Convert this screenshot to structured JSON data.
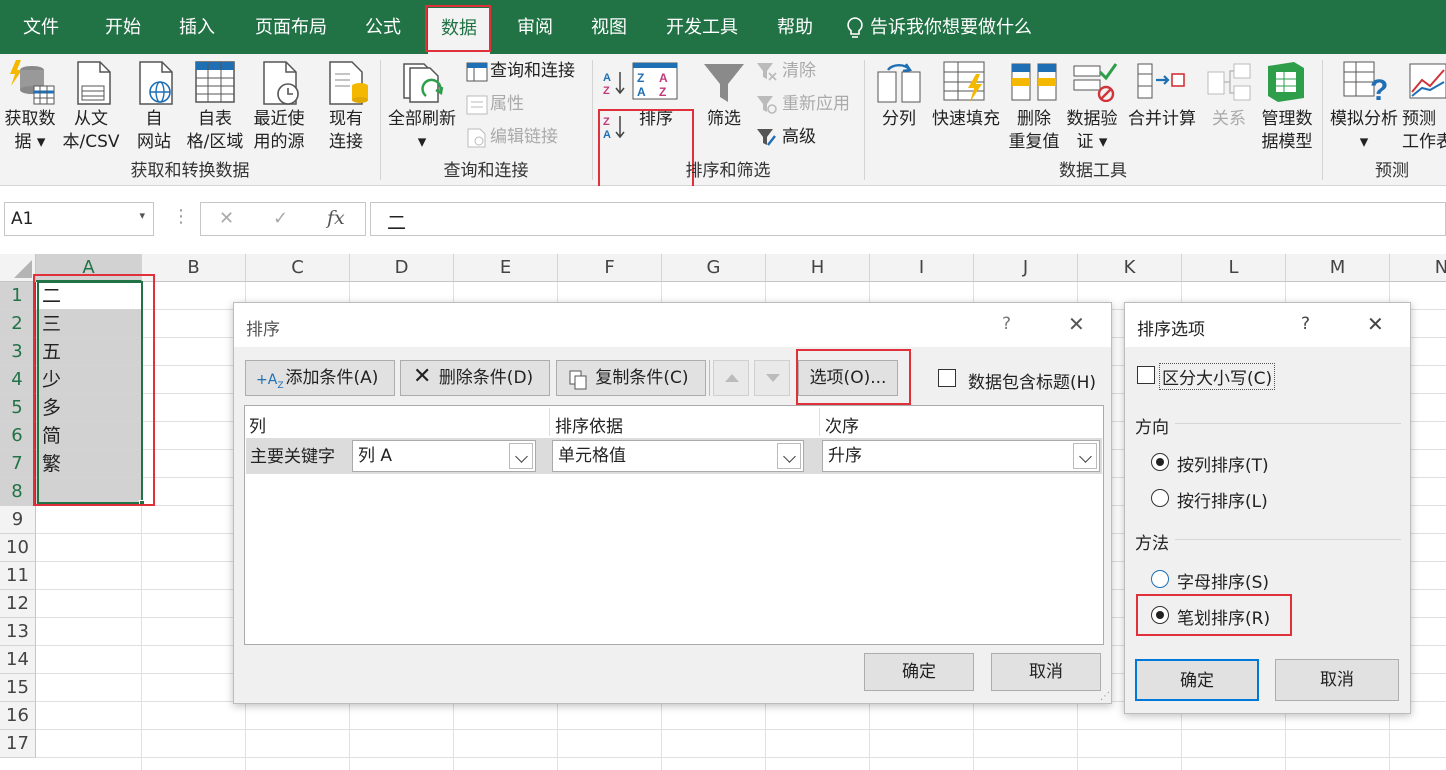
{
  "menu": {
    "tabs": [
      "文件",
      "开始",
      "插入",
      "页面布局",
      "公式",
      "数据",
      "审阅",
      "视图",
      "开发工具",
      "帮助"
    ],
    "tell_me": "告诉我你想要做什么"
  },
  "ribbon": {
    "get_data": {
      "l1": "获取数",
      "l2": "据"
    },
    "from_csv": {
      "l1": "从文",
      "l2": "本/CSV"
    },
    "from_web": {
      "l1": "自",
      "l2": "网站"
    },
    "from_table": {
      "l1": "自表",
      "l2": "格/区域"
    },
    "recent_sources": {
      "l1": "最近使",
      "l2": "用的源"
    },
    "existing_conn": {
      "l1": "现有",
      "l2": "连接"
    },
    "group_get": "获取和转换数据",
    "refresh_all": "全部刷新",
    "queries_conn": "查询和连接",
    "properties": "属性",
    "edit_links": "编辑链接",
    "group_query": "查询和连接",
    "sort": "排序",
    "filter": "筛选",
    "clear": "清除",
    "reapply": "重新应用",
    "advanced": "高级",
    "group_sort": "排序和筛选",
    "text_to_col": "分列",
    "flash_fill": "快速填充",
    "remove_dup": {
      "l1": "删除",
      "l2": "重复值"
    },
    "data_valid": {
      "l1": "数据验",
      "l2": "证"
    },
    "consolidate": "合并计算",
    "relations": "关系",
    "data_model": {
      "l1": "管理数",
      "l2": "据模型"
    },
    "group_tools": "数据工具",
    "what_if": "模拟分析",
    "forecast_sheet": {
      "l1": "预测",
      "l2": "工作表"
    },
    "group_forecast": "预测"
  },
  "formula_bar": {
    "name_box": "A1",
    "cancel": "✕",
    "enter": "✓",
    "fx": "fx",
    "value": "二"
  },
  "columns": [
    "A",
    "B",
    "C",
    "D",
    "E",
    "F",
    "G",
    "H",
    "I",
    "J",
    "K",
    "L",
    "M",
    "N"
  ],
  "rows": [
    "1",
    "2",
    "3",
    "4",
    "5",
    "6",
    "7",
    "8",
    "9",
    "10",
    "11",
    "12",
    "13",
    "14",
    "15",
    "16",
    "17"
  ],
  "cells_a": [
    "二",
    "三",
    "五",
    "少",
    "多",
    "简",
    "繁"
  ],
  "sort_dialog": {
    "title": "排序",
    "help": "?",
    "close": "✕",
    "add_level": "添加条件(A)",
    "delete_level": "删除条件(D)",
    "copy_level": "复制条件(C)",
    "options": "选项(O)...",
    "has_headers": "数据包含标题(H)",
    "hdr_column": "列",
    "hdr_sort_on": "排序依据",
    "hdr_order": "次序",
    "row_label": "主要关键字",
    "column_value": "列 A",
    "sort_on_value": "单元格值",
    "order_value": "升序",
    "ok": "确定",
    "cancel": "取消"
  },
  "options_dialog": {
    "title": "排序选项",
    "help": "?",
    "close": "✕",
    "case_sensitive": "区分大小写(C)",
    "orientation": "方向",
    "top_to_bottom": "按列排序(T)",
    "left_to_right": "按行排序(L)",
    "method": "方法",
    "letter_sort": "字母排序(S)",
    "stroke_sort": "笔划排序(R)",
    "ok": "确定",
    "cancel": "取消"
  },
  "colors": {
    "excel_green": "#217346",
    "highlight_red": "#e0313a",
    "selection": "#d2d2d2"
  }
}
